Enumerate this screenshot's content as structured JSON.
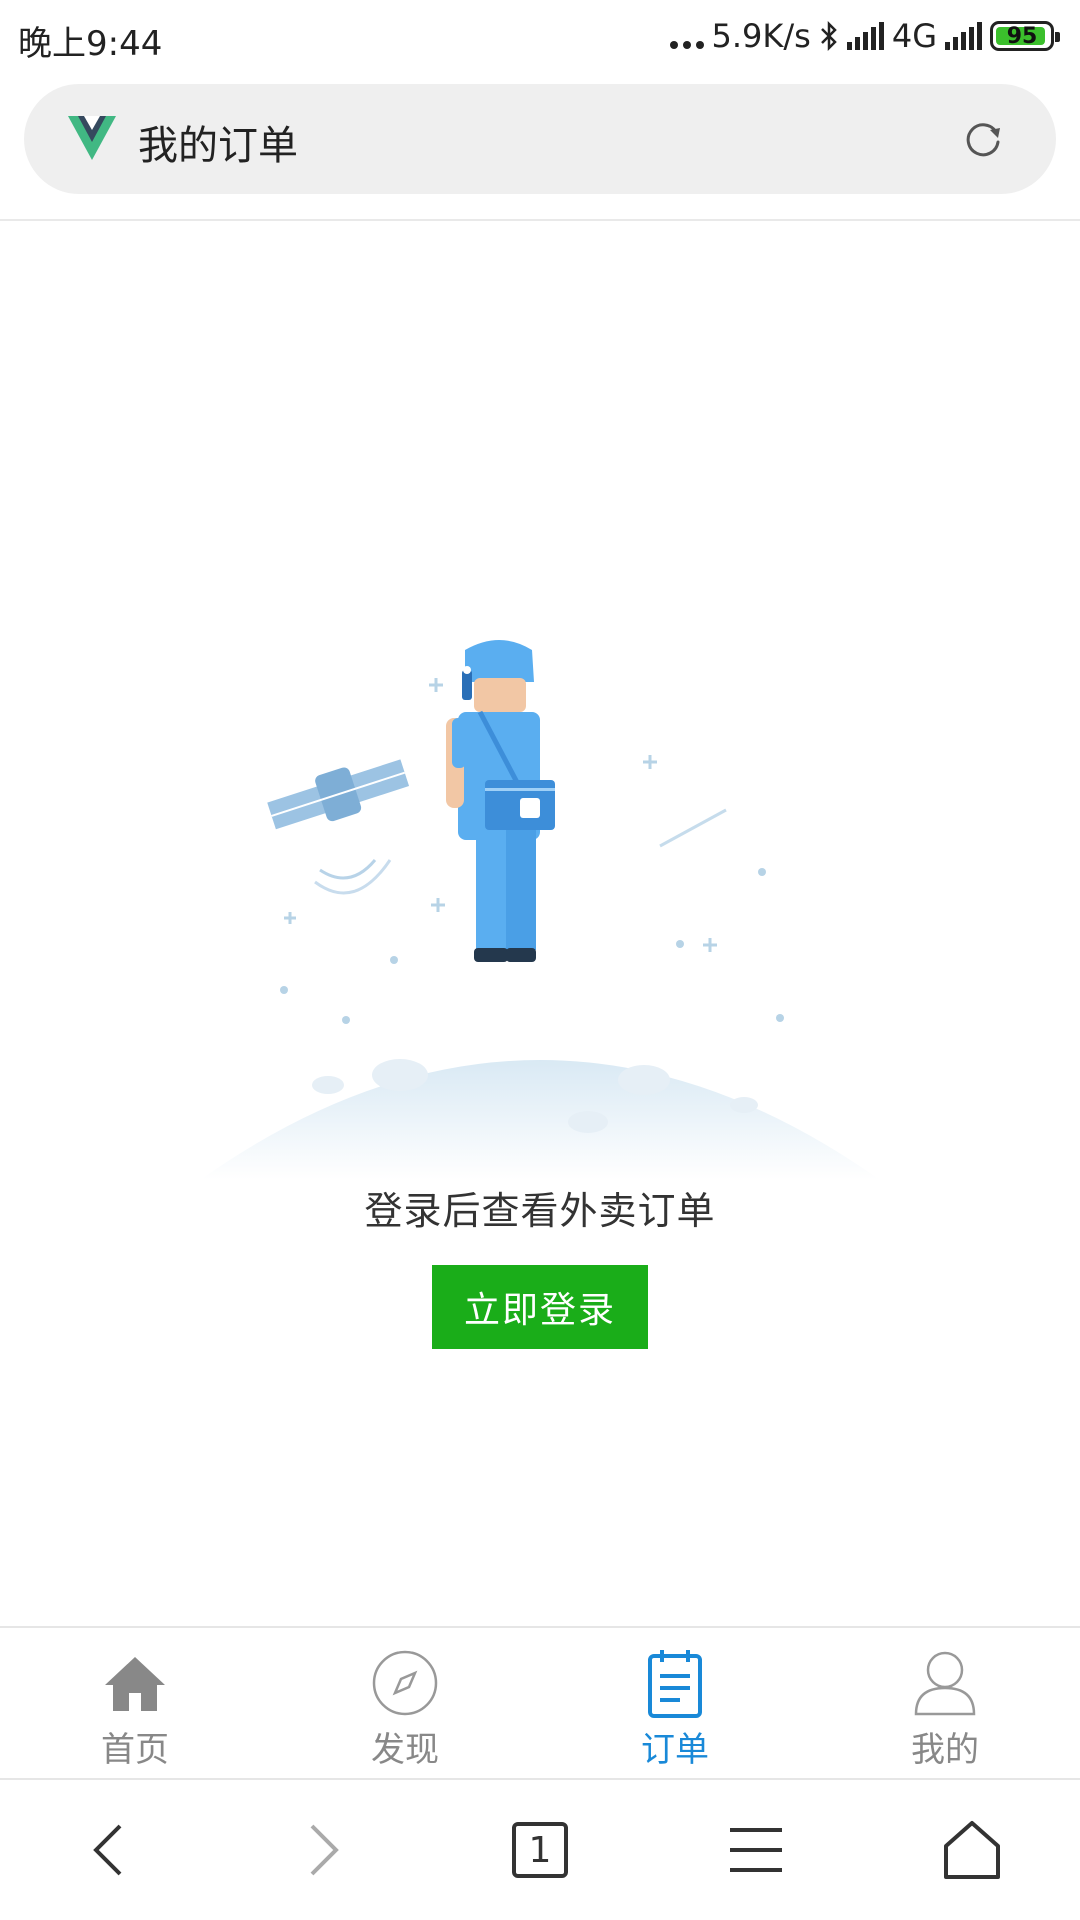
{
  "status_bar": {
    "time": "晚上9:44",
    "net_speed": "5.9K/s",
    "network": "4G",
    "battery": "95"
  },
  "address_bar": {
    "title": "我的订单"
  },
  "main": {
    "empty_message": "登录后查看外卖订单",
    "login_button_label": "立即登录"
  },
  "tab_bar": {
    "items": [
      {
        "label": "首页",
        "icon": "home-icon",
        "active": false
      },
      {
        "label": "发现",
        "icon": "compass-icon",
        "active": false
      },
      {
        "label": "订单",
        "icon": "order-icon",
        "active": true
      },
      {
        "label": "我的",
        "icon": "user-icon",
        "active": false
      }
    ]
  },
  "browser_bar": {
    "tab_count": "1",
    "buttons": [
      "back-arrow-icon",
      "forward-arrow-icon",
      "tabs-icon",
      "menu-icon",
      "home-outline-icon"
    ]
  },
  "colors": {
    "accent_blue": "#1989d8",
    "login_green": "#1aad19",
    "battery_green": "#3bbf2c",
    "vue_green": "#41b883",
    "vue_dark": "#35495e"
  }
}
